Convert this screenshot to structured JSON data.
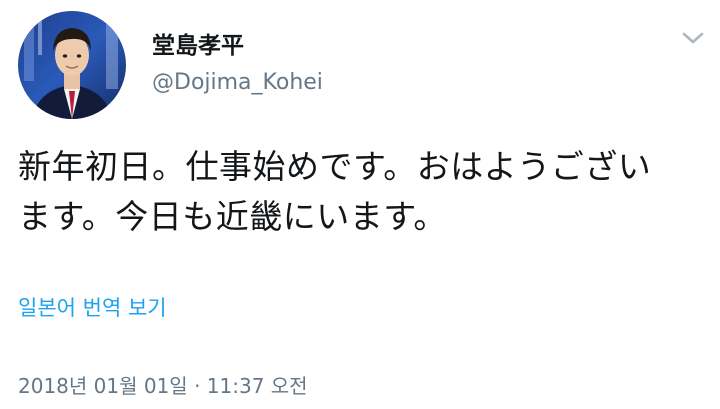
{
  "user": {
    "display_name": "堂島孝平",
    "handle": "@Dojima_Kohei"
  },
  "menu": {
    "icon": "chevron-down-icon"
  },
  "tweet": {
    "line1": "新年初日。仕事始めです。おはようござい",
    "line2": "ます。今日も近畿にいます。"
  },
  "translate": {
    "label": "일본어 번역 보기"
  },
  "meta": {
    "timestamp": "2018년 01월 01일 · 11:37 오전"
  },
  "colors": {
    "text": "#14171a",
    "secondary": "#657786",
    "link": "#1da1f2"
  }
}
